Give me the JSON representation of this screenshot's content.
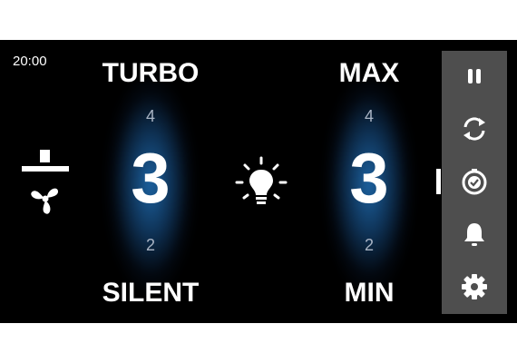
{
  "status": {
    "time": "20:00"
  },
  "fan": {
    "icon": "hood-fan-icon",
    "max_label": "TURBO",
    "min_label": "SILENT",
    "next_level": "4",
    "current_level": "3",
    "previous_level": "2"
  },
  "light": {
    "icon": "light-bulb-icon",
    "max_label": "MAX",
    "min_label": "MIN",
    "next_level": "4",
    "current_level": "3",
    "previous_level": "2"
  },
  "sidebar": {
    "items": [
      {
        "icon": "pause-icon"
      },
      {
        "icon": "refresh-icon"
      },
      {
        "icon": "timer-check-icon"
      },
      {
        "icon": "bell-icon"
      },
      {
        "icon": "gear-icon"
      }
    ]
  },
  "colors": {
    "background": "#000000",
    "glow": "#1e68aa",
    "sidebar": "#4e4e4e",
    "secondary_numbers": "#a9b4c4",
    "icons": "#ffffff"
  }
}
